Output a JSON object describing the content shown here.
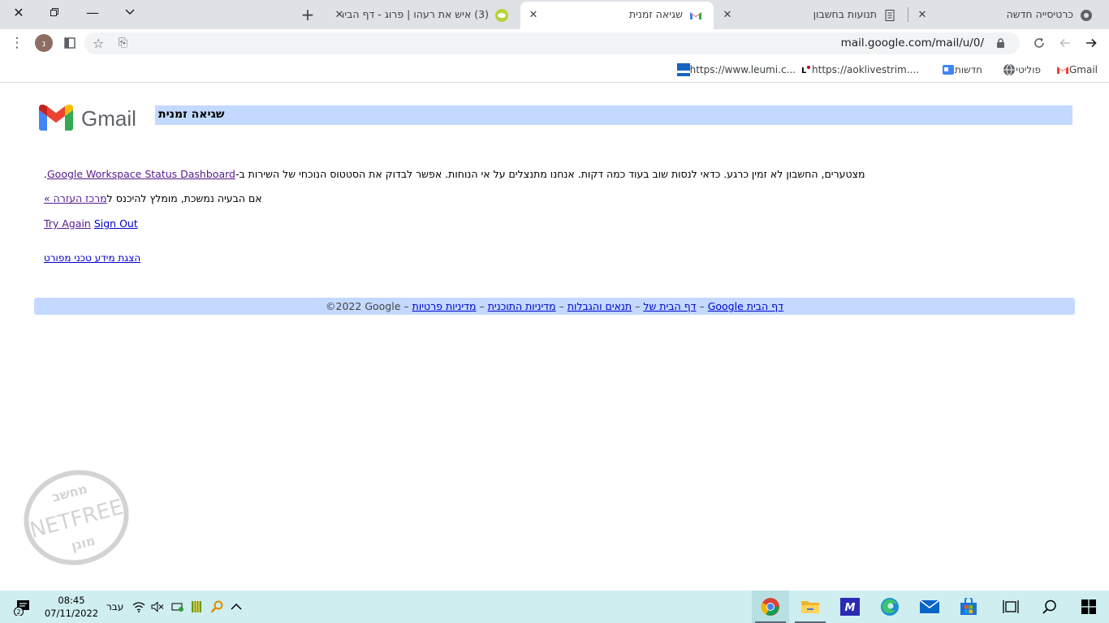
{
  "browser": {
    "tabs": [
      {
        "title": "כרטיסייה חדשה",
        "favicon": "chrome-icon",
        "active": false
      },
      {
        "title": "תנועות בחשבון",
        "favicon": "document-icon",
        "active": false
      },
      {
        "title": "שגיאה זמנית",
        "favicon": "gmail-icon",
        "active": true
      },
      {
        "title": "(3) איש את רעהו | פרוג - דף הבית",
        "favicon": "forum-icon",
        "active": false
      }
    ],
    "url": "mail.google.com/mail/u/0/",
    "avatar_letter": "נ",
    "bookmarks": [
      {
        "label": "Gmail",
        "icon": "gmail-icon"
      },
      {
        "label": "פוליטי",
        "icon": "globe-icon"
      },
      {
        "label": "חדשות",
        "icon": "news-icon"
      },
      {
        "label": "https://aoklivestrim....",
        "icon": "live-icon"
      },
      {
        "label": "https://www.leumi.c...",
        "icon": "bank-icon"
      }
    ]
  },
  "page": {
    "logo_text": "Gmail",
    "title": "שגיאה זמנית",
    "message_prefix": "מצטערים, החשבון לא זמין כרגע. כדאי לנסות שוב בעוד כמה דקות. אנחנו מתנצלים על אי הנוחות. אפשר לבדוק את הסטטוס הנוכחי של השירות ב-",
    "status_link": "Google Workspace Status Dashboard",
    "status_suffix": ".",
    "help_prefix": "אם הבעיה נמשכת, מומלץ להיכנס ל",
    "help_link": "מרכז העזרה",
    "help_arrow": "»",
    "try_again": "Try Again",
    "sign_out": "Sign Out",
    "technical_details": "הצגת מידע טכני מפורט",
    "footer": {
      "google_home": "Google דף הבית",
      "sep": " – ",
      "privacy": "מדיניות פרטיות",
      "program_policy": "מדיניות התוכנית",
      "terms": "תנאים והגבלות",
      "homepage_of": "דף הבית של",
      "copyright": "©2022 Google"
    }
  },
  "watermark": {
    "top": "מחשב",
    "middle": "NETFREE",
    "bottom": "מוגן"
  },
  "taskbar": {
    "time": "08:45",
    "date": "07/11/2022",
    "lang": "עבר",
    "notification_count": "2",
    "apps": [
      "chrome-icon",
      "file-explorer-icon",
      "editor-icon",
      "edge-icon",
      "mail-icon",
      "store-icon"
    ]
  },
  "colors": {
    "title_bar": "#c3d9ff",
    "link": "#0000cc",
    "visited": "#551a8b",
    "taskbar": "#cfeeef"
  }
}
